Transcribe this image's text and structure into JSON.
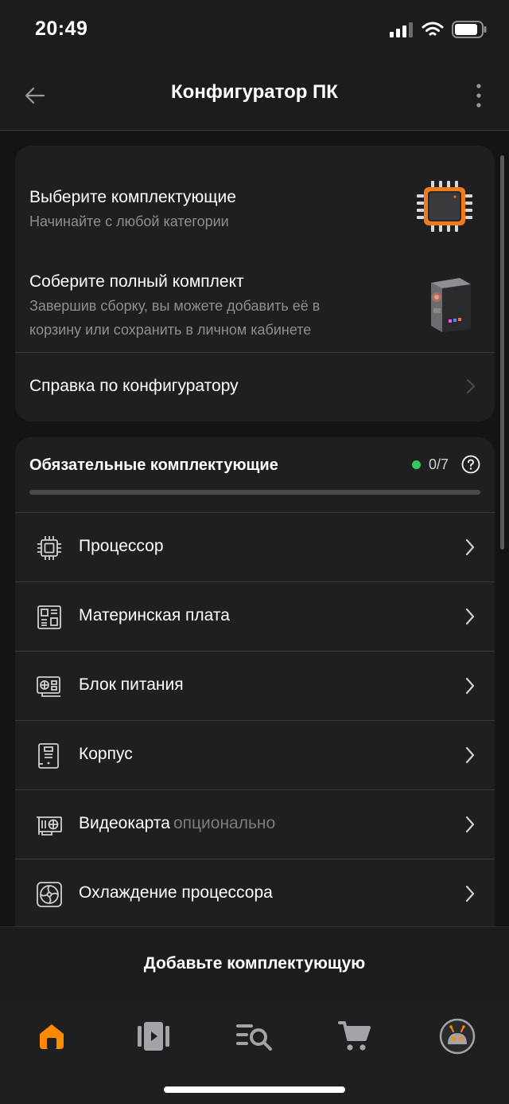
{
  "status": {
    "time": "20:49"
  },
  "header": {
    "title": "Конфигуратор ПК"
  },
  "info": {
    "step1": {
      "title": "Выберите комплектующие",
      "subtitle": "Начинайте с любой категории"
    },
    "step2": {
      "title": "Соберите полный комплект",
      "subtitle_line1": "Завершив сборку, вы можете добавить её в",
      "subtitle_line2": "корзину или сохранить в личном кабинете"
    },
    "help": "Справка по конфигуратору"
  },
  "required": {
    "title": "Обязательные комплектующие",
    "count": "0/7",
    "progress": 0,
    "items": [
      {
        "label": "Процессор",
        "icon": "cpu-icon",
        "note": ""
      },
      {
        "label": "Материнская плата",
        "icon": "motherboard-icon",
        "note": ""
      },
      {
        "label": "Блок питания",
        "icon": "power-supply-icon",
        "note": ""
      },
      {
        "label": "Корпус",
        "icon": "case-icon",
        "note": ""
      },
      {
        "label": "Видеокарта",
        "icon": "gpu-icon",
        "note": "опционально"
      },
      {
        "label": "Охлаждение процессора",
        "icon": "cooler-icon",
        "note": ""
      }
    ]
  },
  "add_bar": {
    "label": "Добавьте комплектующую"
  },
  "tabs": [
    "home-icon",
    "catalog-icon",
    "search-list-icon",
    "cart-icon",
    "profile-icon"
  ],
  "colors": {
    "accent": "#ff8a00",
    "status_dot": "#34c759",
    "background": "#141414",
    "card": "#1f1f21"
  }
}
